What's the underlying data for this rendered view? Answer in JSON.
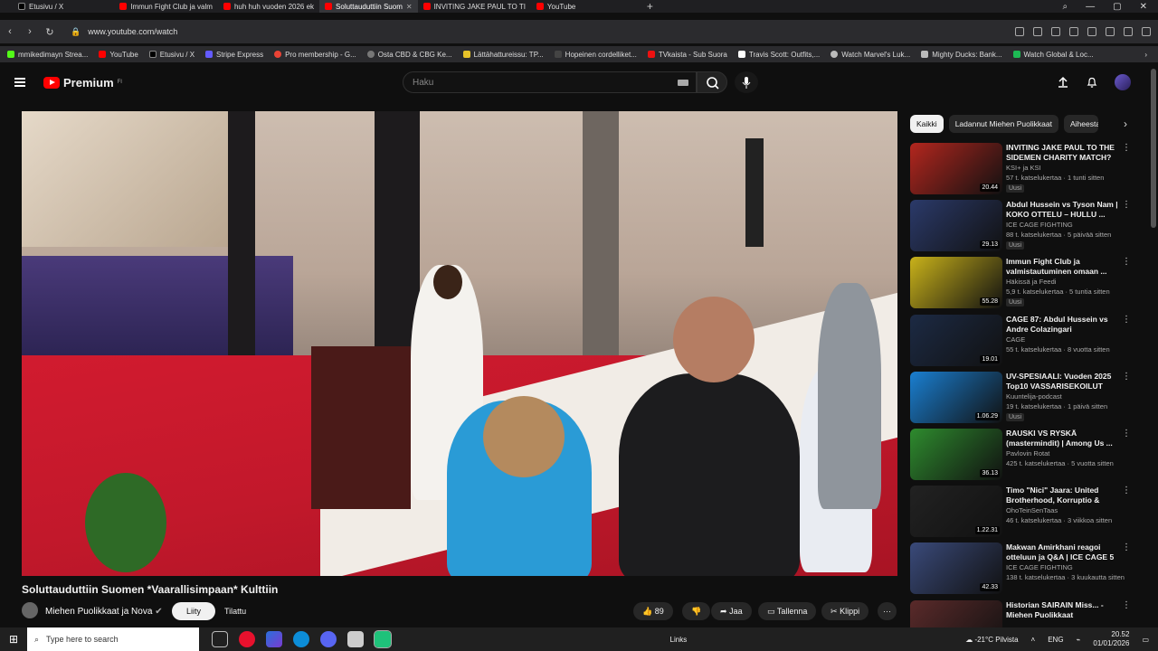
{
  "browser": {
    "tabs": [
      {
        "label": "Etusivu / X",
        "icon": "x-icon",
        "active": false
      },
      {
        "label": "Immun Fight Club ja valm",
        "icon": "youtube-icon",
        "active": false
      },
      {
        "label": "huh huh vuoden 2026 ek",
        "icon": "youtube-icon",
        "active": false
      },
      {
        "label": "Soluttauduttiin Suom",
        "icon": "youtube-icon",
        "active": true
      },
      {
        "label": "INVITING JAKE PAUL TO TI",
        "icon": "youtube-icon",
        "active": false
      },
      {
        "label": "YouTube",
        "icon": "youtube-icon",
        "active": false
      }
    ],
    "url": "www.youtube.com/watch",
    "bookmarks": [
      "mmikedimayn Strea...",
      "YouTube",
      "Etusivu / X",
      "Stripe Express",
      "Pro membership - G...",
      "Osta CBD & CBG Ke...",
      "Lättähattureissu: TP...",
      "Hopeinen cordelliket...",
      "TVkaista - Sub Suora",
      "Travis Scott: Outfits,...",
      "Watch Marvel's Luk...",
      "Mighty Ducks: Bank...",
      "Watch Global & Loc..."
    ]
  },
  "header": {
    "logo": "Premium",
    "logo_region": "FI",
    "search_placeholder": "Haku"
  },
  "video": {
    "title": "Soluttauduttiin Suomen *Vaarallisimpaan* Kulttiin",
    "channel": "Miehen Puolikkaat ja Nova",
    "join_label": "Liity",
    "subscribed_label": "Tilattu",
    "likes": "89",
    "share_label": "Jaa",
    "save_label": "Tallenna",
    "clip_label": "Klippi"
  },
  "sidebar": {
    "chips": [
      "Kaikki",
      "Ladannut Miehen Puolikkaat",
      "Aiheesta"
    ],
    "recommendations": [
      {
        "title": "INVITING JAKE PAUL TO THE SIDEMEN CHARITY MATCH?",
        "channel": "KSI+ ja KSI",
        "meta": "57 t. katselukertaa · 1 tunti sitten",
        "duration": "20.44",
        "badge": "Uusi",
        "color": "#b3261e"
      },
      {
        "title": "Abdul Hussein vs Tyson Nam | KOKO OTTELU – HULLU ...",
        "channel": "ICE CAGE FIGHTING",
        "meta": "88 t. katselukertaa · 5 päivää sitten",
        "duration": "29.13",
        "badge": "Uusi",
        "color": "#2b3a6a"
      },
      {
        "title": "Immun Fight Club ja valmistautuminen omaan ...",
        "channel": "Häkissä ja Feedi",
        "meta": "5,9 t. katselukertaa · 5 tuntia sitten",
        "duration": "55.28",
        "badge": "Uusi",
        "color": "#c9b21a"
      },
      {
        "title": "CAGE 87: Abdul Hussein vs Andre Colazingari",
        "channel": "CAGE",
        "meta": "55 t. katselukertaa · 8 vuotta sitten",
        "duration": "19.01",
        "badge": "",
        "color": "#1c2a44"
      },
      {
        "title": "UV-SPESIAALI: Vuoden 2025 Top10 VASSARISEKOILUT",
        "channel": "Kuuntelija-podcast",
        "meta": "19 t. katselukertaa · 1 päivä sitten",
        "duration": "1.06.29",
        "badge": "Uusi",
        "color": "#1a7fd1"
      },
      {
        "title": "RAUSKI VS RYSKÄ (mastermindit) | Among Us ...",
        "channel": "Pavlovin Rotat",
        "meta": "425 t. katselukertaa · 5 vuotta sitten",
        "duration": "36.13",
        "badge": "",
        "color": "#2e8b2e"
      },
      {
        "title": "Timo \"Nici\" Jaara: United Brotherhood, Korruptio & Usko",
        "channel": "OhoTeinSenTaas",
        "meta": "46 t. katselukertaa · 3 viikkoa sitten",
        "duration": "1.22.31",
        "badge": "",
        "color": "#222222"
      },
      {
        "title": "Makwan Amirkhani reagoi otteluun ja Q&A | ICE CAGE 5",
        "channel": "ICE CAGE FIGHTING",
        "meta": "138 t. katselukertaa · 3 kuukautta sitten",
        "duration": "42.33",
        "badge": "",
        "color": "#3a4a7a"
      },
      {
        "title": "Historian SAIRAIN Miss... - Miehen Puolikkaat",
        "channel": "",
        "meta": "",
        "duration": "",
        "badge": "",
        "color": "#5a2a2a"
      }
    ]
  },
  "taskbar": {
    "search_placeholder": "Type here to search",
    "links_label": "Links",
    "weather": "-21°C Pilvista",
    "lang": "ENG",
    "time": "20.52",
    "date": "01/01/2026"
  }
}
